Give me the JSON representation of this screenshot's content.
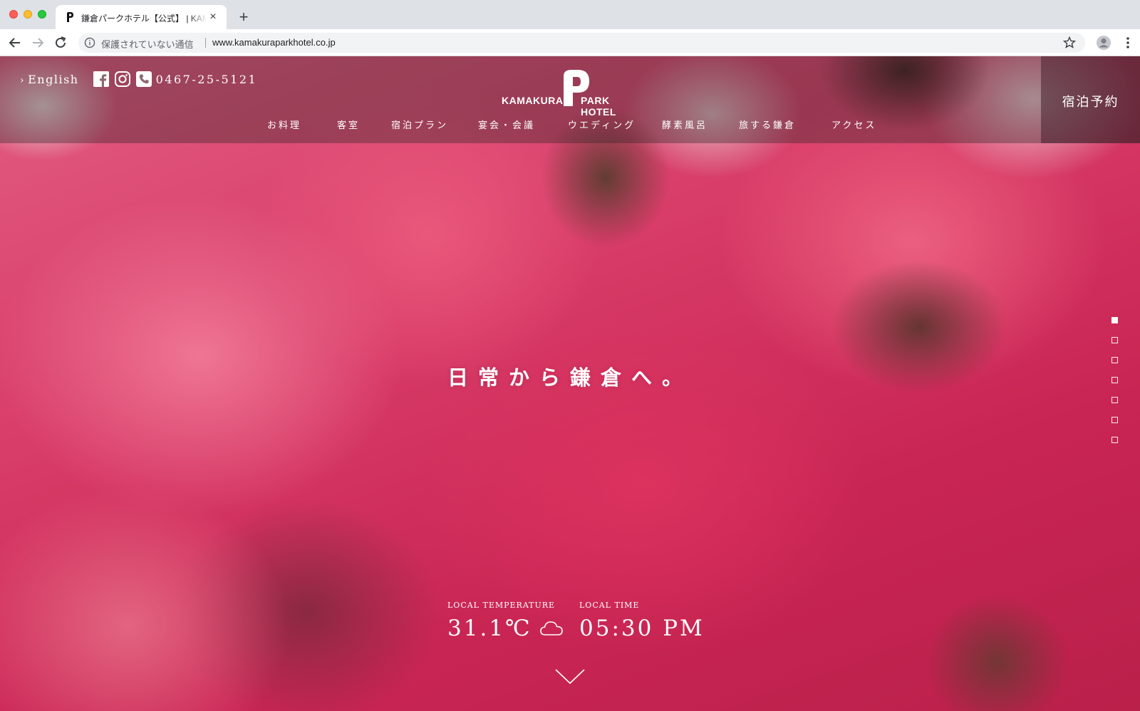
{
  "browser": {
    "tab": {
      "title": "鎌倉パークホテル【公式】 | KAMAKURA PARK HOTEL",
      "close_label": "×"
    },
    "new_tab_label": "+",
    "address_bar": {
      "security_text": "保護されていない通信",
      "url": "www.kamakuraparkhotel.co.jp"
    }
  },
  "header": {
    "language_link": "English",
    "language_chevron": "›",
    "phone_number": "0467-25-5121",
    "logo": {
      "left_text": "KAMAKURA",
      "right_text": "PARK HOTEL"
    },
    "reserve_label": "宿泊予約",
    "nav": [
      {
        "label": "お料理"
      },
      {
        "label": "客室"
      },
      {
        "label": "宿泊プラン"
      },
      {
        "label": "宴会・会議"
      },
      {
        "label": "ウエディング"
      },
      {
        "label": "酵素風呂"
      },
      {
        "label": "旅する鎌倉"
      },
      {
        "label": "アクセス"
      }
    ]
  },
  "hero": {
    "tagline": "日常から鎌倉へ。",
    "slides": {
      "count": 7,
      "active_index": 0
    },
    "temperature": {
      "label": "LOCAL TEMPERATURE",
      "value": "31.1℃",
      "weather_icon": "cloud-icon"
    },
    "time": {
      "label": "LOCAL TIME",
      "value": "05:30 PM"
    }
  },
  "icons": {
    "facebook": "facebook-icon",
    "instagram": "instagram-icon",
    "phone": "phone-icon",
    "scroll_down": "chevron-down-icon"
  },
  "colors": {
    "accent_pink": "#d73a66",
    "reserve_panel": "#46232d",
    "text": "#ffffff"
  }
}
